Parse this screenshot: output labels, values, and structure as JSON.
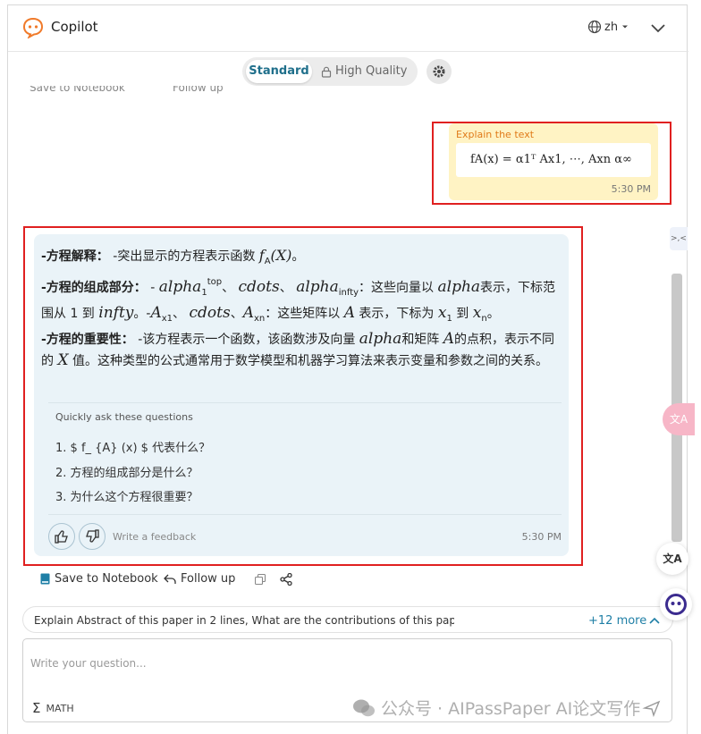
{
  "header": {
    "app_title": "Copilot",
    "language": "zh",
    "icons": [
      "copilot-logo-icon",
      "globe-icon",
      "caret-down-icon",
      "chevron-down-icon"
    ]
  },
  "mode": {
    "standard_label": "Standard",
    "high_quality_label": "High Quality",
    "active": "Standard"
  },
  "ghost_actions": {
    "save_label": "Save to Notebook",
    "follow_label": "Follow up"
  },
  "user_message": {
    "label": "Explain the text",
    "formula": "fA(x) = α1ᵀ Ax1, ⋯, Axn α∞",
    "time": "5:30 PM"
  },
  "side_tab": ">,<",
  "assistant": {
    "line1_prefix": "-方程解释：",
    "line1_text": " -突出显示的方程表示函数 ",
    "line1_math": "f",
    "line1_math_sub": "A",
    "line1_math_arg": "(X)",
    "line1_end": "。",
    "line2_prefix": "-方程的组成部分：",
    "line2_a": " - ",
    "alpha": "alpha",
    "sub_1": "1",
    "sup_top": "top",
    "sep1": "、 ",
    "cdots": "cdots",
    "sep2": "、 ",
    "sub_infty": "infty",
    "line2_b": "：这些向量以 ",
    "line2_c": "表示，下标范围从 1 到 ",
    "infty": "infty",
    "line2_d": "。-",
    "A": "A",
    "sub_x1": "x",
    "sub_x1_n": "1",
    "sep3": "、 ",
    "sep4": "、",
    "sub_xn": "x",
    "sub_xn_n": "n",
    "line2_e": "：这些矩阵以 ",
    "line2_f": " 表示，下标为 ",
    "x": "x",
    "x_sub_1": "1",
    "line2_g": " 到 ",
    "x_sub_n": "n",
    "line2_h": "。",
    "line3_prefix": "-方程的重要性：",
    "line3_a": " -该方程表示一个函数，该函数涉及向量 ",
    "line3_b": "和矩阵 ",
    "line3_c": "的点积，表示不同的 ",
    "X": "X",
    "line3_d": " 值。这种类型的公式通常用于数学模型和机器学习算法来表示变量和参数之间的关系。",
    "quick_title": "Quickly ask these questions",
    "questions": [
      "1. $ f_ {A} (x) $ 代表什么？",
      "2. 方程的组成部分是什么？",
      "3. 为什么这个方程很重要？"
    ],
    "feedback_placeholder": "Write a feedback",
    "time": "5:30 PM"
  },
  "actions": {
    "save_label": "Save to Notebook",
    "follow_label": "Follow up"
  },
  "suggestion": {
    "text": "Explain Abstract of this paper in 2 lines, What are the contributions of this pap",
    "more": "+12 more"
  },
  "input": {
    "placeholder": "Write your question...",
    "math_label": "MATH"
  },
  "floating": {
    "translate_label": "文A"
  },
  "watermark": "公众号 · AIPassPaper AI论文写作",
  "colors": {
    "accent": "#1f6f8b",
    "logo_orange": "#f07a2a",
    "user_bubble": "#fff3c4",
    "assistant_bubble": "#eaf3f8",
    "highlight_red": "#e02020"
  }
}
